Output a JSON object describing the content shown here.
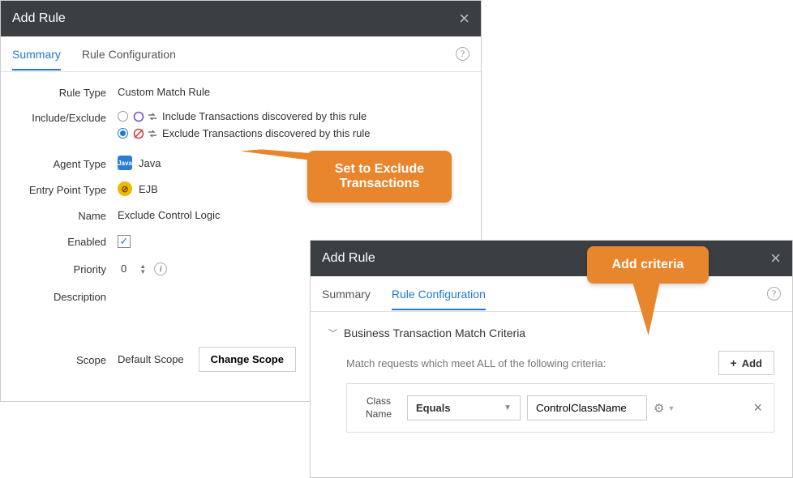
{
  "dialog1": {
    "title": "Add Rule",
    "tabs": {
      "summary": "Summary",
      "config": "Rule Configuration"
    },
    "activeTab": "summary",
    "labels": {
      "ruleType": "Rule Type",
      "includeExclude": "Include/Exclude",
      "agentType": "Agent Type",
      "entryPointType": "Entry Point Type",
      "name": "Name",
      "enabled": "Enabled",
      "priority": "Priority",
      "description": "Description",
      "scope": "Scope"
    },
    "values": {
      "ruleType": "Custom Match Rule",
      "includeOption": "Include Transactions discovered by this rule",
      "excludeOption": "Exclude Transactions discovered by this rule",
      "selectedIncludeExclude": "exclude",
      "agentType": "Java",
      "agentIcon": "Java",
      "entryPointType": "EJB",
      "name": "Exclude Control Logic",
      "enabled": true,
      "priority": "0",
      "description": "",
      "scope": "Default Scope",
      "changeScopeBtn": "Change Scope"
    }
  },
  "dialog2": {
    "title": "Add Rule",
    "tabs": {
      "summary": "Summary",
      "config": "Rule Configuration"
    },
    "activeTab": "config",
    "sectionTitle": "Business Transaction Match Criteria",
    "matchText": "Match requests which meet ALL of the following criteria:",
    "addBtn": "Add",
    "criteria": {
      "label": "Class Name",
      "operator": "Equals",
      "value": "ControlClassName"
    }
  },
  "callouts": {
    "c1": "Set to Exclude Transactions",
    "c2": "Add criteria"
  }
}
